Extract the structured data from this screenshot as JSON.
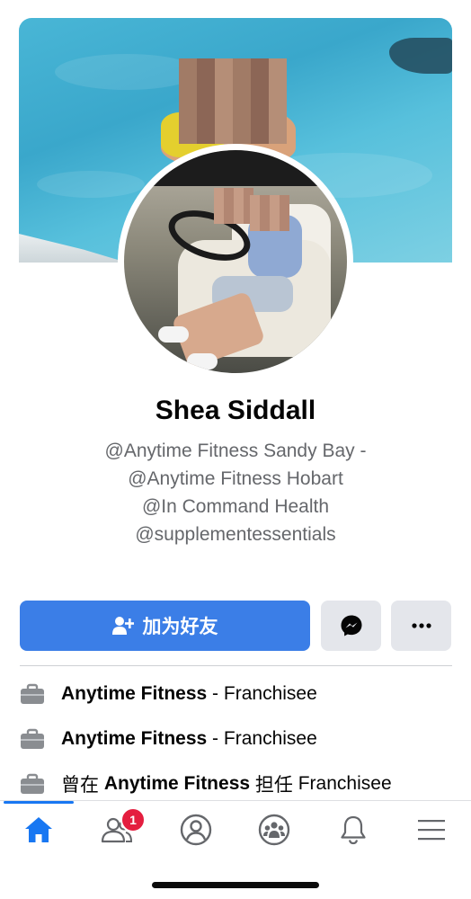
{
  "profile": {
    "name": "Shea Siddall",
    "bio_lines": [
      "@Anytime Fitness Sandy Bay -",
      "@Anytime Fitness Hobart",
      "@In Command Health",
      "@supplementessentials"
    ]
  },
  "actions": {
    "add_friend_label": "加为好友",
    "messenger_icon": "messenger-icon",
    "more_icon": "more-horizontal-icon"
  },
  "work": [
    {
      "company": "Anytime Fitness",
      "separator": " - ",
      "role": "Franchisee"
    },
    {
      "company": "Anytime Fitness",
      "separator": " - ",
      "role": "Franchisee"
    },
    {
      "prefix": "曾在 ",
      "company": "Anytime Fitness",
      "middle": " 担任 ",
      "role": "Franchisee"
    }
  ],
  "tabbar": {
    "tabs": [
      "home-icon",
      "friends-icon",
      "profile-icon",
      "groups-icon",
      "notifications-icon",
      "menu-icon"
    ],
    "active_tab": "home-icon",
    "friends_badge": "1"
  },
  "colors": {
    "accent": "#1877f2",
    "button_blue": "#3b7ee7",
    "secondary_button": "#e4e6eb",
    "muted_text": "#65676b",
    "badge_red": "#e41e3f"
  }
}
